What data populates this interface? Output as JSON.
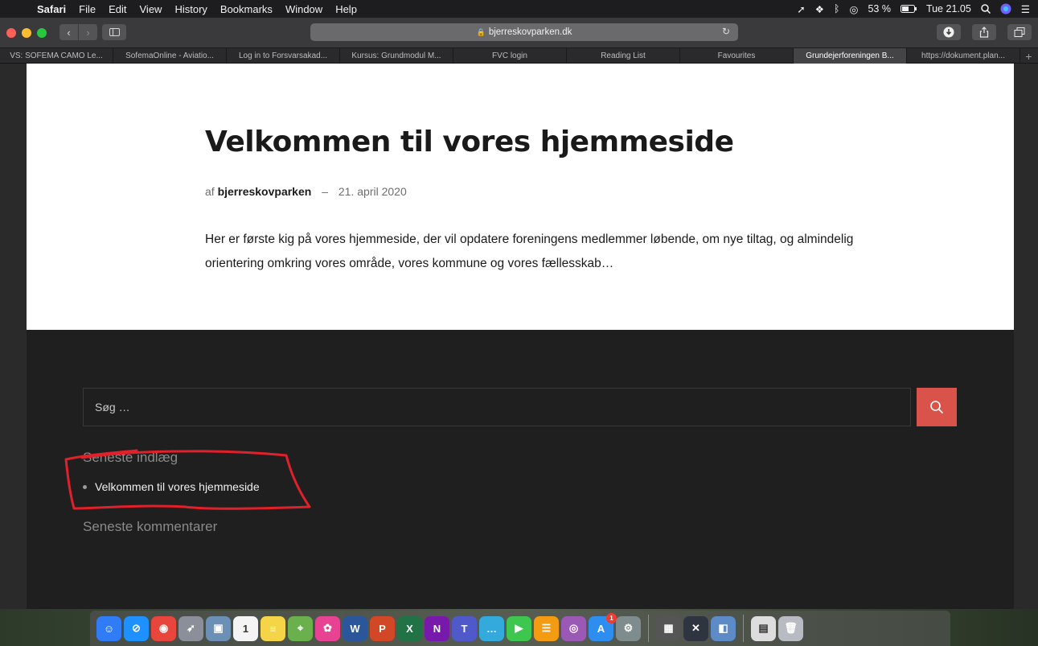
{
  "menubar": {
    "items": [
      "Safari",
      "File",
      "Edit",
      "View",
      "History",
      "Bookmarks",
      "Window",
      "Help"
    ],
    "battery": "53 %",
    "clock": "Tue 21.05"
  },
  "toolbar": {
    "url": "bjerreskovparken.dk"
  },
  "tabs": [
    {
      "label": "VS: SOFEMA CAMO Le...",
      "active": false
    },
    {
      "label": "SofemaOnline - Aviatio...",
      "active": false
    },
    {
      "label": "Log in to Forsvarsakad...",
      "active": false
    },
    {
      "label": "Kursus: Grundmodul M...",
      "active": false
    },
    {
      "label": "FVC login",
      "active": false
    },
    {
      "label": "Reading List",
      "active": false
    },
    {
      "label": "Favourites",
      "active": false
    },
    {
      "label": "Grundejerforeningen B...",
      "active": true
    },
    {
      "label": "https://dokument.plan...",
      "active": false
    }
  ],
  "article": {
    "title": "Velkommen til vores hjemmeside",
    "by_prefix": "af",
    "author": "bjerreskovparken",
    "separator": "–",
    "date": "21. april 2020",
    "body": "Her er første kig på vores hjemmeside, der vil opdatere foreningens medlemmer løbende, om nye tiltag, og almindelig orientering omkring vores område, vores kommune og vores fællesskab…"
  },
  "footer": {
    "search_placeholder": "Søg …",
    "recent_posts_title": "Seneste indlæg",
    "recent_posts": [
      "Velkommen til vores hjemmeside"
    ],
    "recent_comments_title": "Seneste kommentarer"
  },
  "colors": {
    "accent": "#d9534a",
    "annotation": "#e0202a"
  },
  "dock": {
    "apps": [
      {
        "name": "finder-icon",
        "color": "#2f7cf6",
        "glyph": "☺"
      },
      {
        "name": "safari-icon",
        "color": "#1e90ff",
        "glyph": "⊘"
      },
      {
        "name": "chrome-icon",
        "color": "#e8453c",
        "glyph": "◉"
      },
      {
        "name": "launchpad-icon",
        "color": "#8a8f99",
        "glyph": "➶"
      },
      {
        "name": "preview-photo-icon",
        "color": "#6b8fb5",
        "glyph": "▣"
      },
      {
        "name": "calendar-icon",
        "color": "#f4f4f4",
        "glyph": "1"
      },
      {
        "name": "notes-icon",
        "color": "#f5d547",
        "glyph": "≡"
      },
      {
        "name": "maps-icon",
        "color": "#6ab04c",
        "glyph": "⌖"
      },
      {
        "name": "photos-icon",
        "color": "#e84393",
        "glyph": "✿"
      },
      {
        "name": "word-icon",
        "color": "#2b579a",
        "glyph": "W"
      },
      {
        "name": "powerpoint-icon",
        "color": "#d24726",
        "glyph": "P"
      },
      {
        "name": "excel-icon",
        "color": "#217346",
        "glyph": "X"
      },
      {
        "name": "onenote-icon",
        "color": "#7719aa",
        "glyph": "N"
      },
      {
        "name": "teams-icon",
        "color": "#5059c9",
        "glyph": "T"
      },
      {
        "name": "messages-icon",
        "color": "#34aadc",
        "glyph": "…"
      },
      {
        "name": "facetime-icon",
        "color": "#3ec74f",
        "glyph": "▶"
      },
      {
        "name": "books-icon",
        "color": "#f39c12",
        "glyph": "☰"
      },
      {
        "name": "podcasts-icon",
        "color": "#9b59b6",
        "glyph": "◎"
      },
      {
        "name": "app-store-icon",
        "color": "#2d8ef0",
        "glyph": "A"
      },
      {
        "name": "system-preferences-icon",
        "color": "#7f8c8d",
        "glyph": "⚙"
      },
      {
        "name": "calculator-icon",
        "color": "#555555",
        "glyph": "▦"
      },
      {
        "name": "x-app-icon",
        "color": "#2e3440",
        "glyph": "✕"
      },
      {
        "name": "preview-icon",
        "color": "#5d8bc7",
        "glyph": "◧"
      },
      {
        "name": "document-icon",
        "color": "#dddddd",
        "glyph": "▤"
      },
      {
        "name": "trash-icon",
        "color": "#b8bcc2",
        "glyph": "🗑"
      }
    ],
    "app_store_badge": "1",
    "calendar_month": "SEP"
  }
}
